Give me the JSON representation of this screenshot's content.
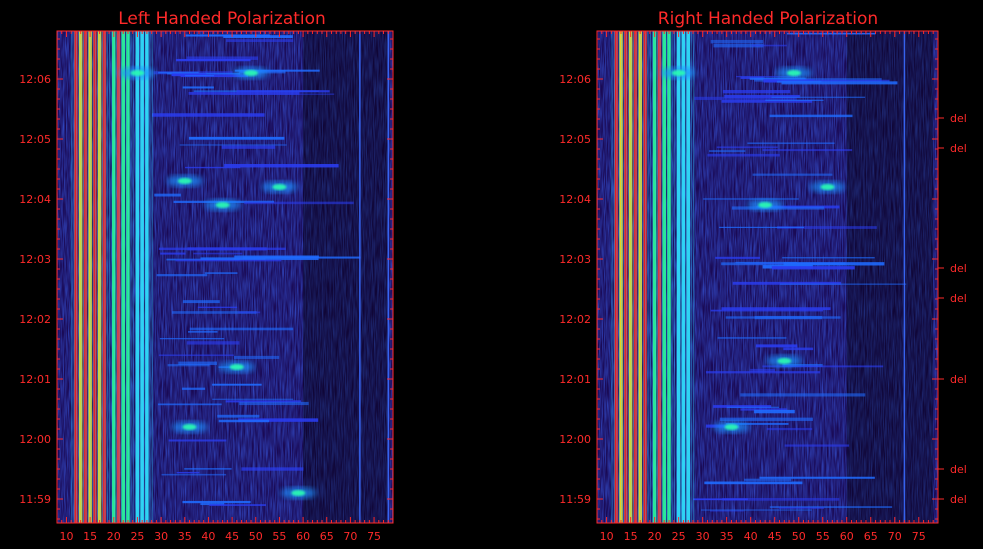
{
  "chart_data": [
    {
      "type": "heatmap",
      "title": "Left Handed Polarization",
      "x_ticks": [
        "10",
        "15",
        "20",
        "25",
        "30",
        "35",
        "40",
        "45",
        "50",
        "55",
        "60",
        "65",
        "70",
        "75"
      ],
      "x_values": [
        10,
        15,
        20,
        25,
        30,
        35,
        40,
        45,
        50,
        55,
        60,
        65,
        70,
        75
      ],
      "xlim": [
        8,
        79
      ],
      "y_ticks": [
        "12:06",
        "12:05",
        "12:04",
        "12:03",
        "12:02",
        "12:01",
        "12:00",
        "11:59"
      ],
      "y_minutes": [
        366,
        365,
        364,
        363,
        362,
        361,
        360,
        359
      ],
      "ylim": [
        358.6,
        366.8
      ],
      "bright_columns": [
        12,
        13,
        14,
        15,
        16,
        17,
        18,
        20,
        21,
        22,
        23,
        25,
        26,
        27,
        72,
        78
      ],
      "features": [
        {
          "x": 49,
          "y": 366.1,
          "label": ""
        },
        {
          "x": 25,
          "y": 366.1,
          "label": ""
        },
        {
          "x": 43,
          "y": 363.9,
          "label": ""
        },
        {
          "x": 55,
          "y": 364.2,
          "label": ""
        },
        {
          "x": 35,
          "y": 364.3,
          "label": ""
        },
        {
          "x": 46,
          "y": 361.2,
          "label": ""
        },
        {
          "x": 36,
          "y": 360.2,
          "label": ""
        },
        {
          "x": 59,
          "y": 359.1,
          "label": ""
        }
      ],
      "right_labels": []
    },
    {
      "type": "heatmap",
      "title": "Right Handed Polarization",
      "x_ticks": [
        "10",
        "15",
        "20",
        "25",
        "30",
        "35",
        "40",
        "45",
        "50",
        "55",
        "60",
        "65",
        "70",
        "75"
      ],
      "x_values": [
        10,
        15,
        20,
        25,
        30,
        35,
        40,
        45,
        50,
        55,
        60,
        65,
        70,
        75
      ],
      "xlim": [
        8,
        79
      ],
      "y_ticks": [
        "12:06",
        "12:05",
        "12:04",
        "12:03",
        "12:02",
        "12:01",
        "12:00",
        "11:59"
      ],
      "y_minutes": [
        366,
        365,
        364,
        363,
        362,
        361,
        360,
        359
      ],
      "ylim": [
        358.6,
        366.8
      ],
      "bright_columns": [
        12,
        13,
        14,
        15,
        16,
        17,
        18,
        20,
        21,
        22,
        23,
        25,
        26,
        27,
        72
      ],
      "features": [
        {
          "x": 49,
          "y": 366.1,
          "label": ""
        },
        {
          "x": 25,
          "y": 366.1,
          "label": ""
        },
        {
          "x": 56,
          "y": 364.2,
          "label": ""
        },
        {
          "x": 43,
          "y": 363.9,
          "label": ""
        },
        {
          "x": 47,
          "y": 361.3,
          "label": ""
        },
        {
          "x": 36,
          "y": 360.2,
          "label": ""
        }
      ],
      "right_labels": [
        {
          "text": "del",
          "y": 365.35
        },
        {
          "text": "del",
          "y": 364.85
        },
        {
          "text": "del",
          "y": 362.85
        },
        {
          "text": "del",
          "y": 362.35
        },
        {
          "text": "del",
          "y": 361.0
        },
        {
          "text": "del",
          "y": 359.5
        },
        {
          "text": "del",
          "y": 359.0
        }
      ]
    }
  ]
}
